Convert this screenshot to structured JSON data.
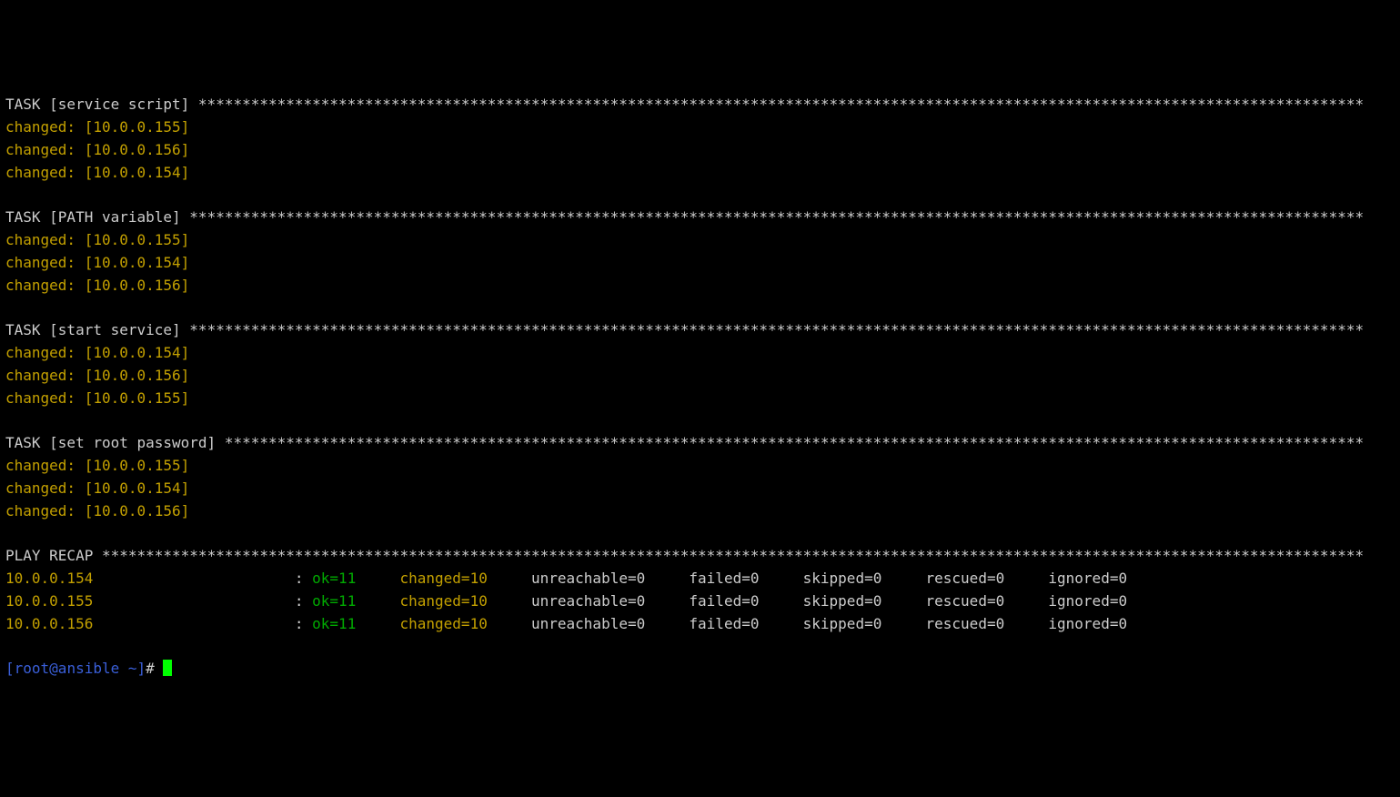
{
  "tasks": [
    {
      "name": "service script",
      "results": [
        {
          "status": "changed",
          "host": "10.0.0.155"
        },
        {
          "status": "changed",
          "host": "10.0.0.156"
        },
        {
          "status": "changed",
          "host": "10.0.0.154"
        }
      ]
    },
    {
      "name": "PATH variable",
      "results": [
        {
          "status": "changed",
          "host": "10.0.0.155"
        },
        {
          "status": "changed",
          "host": "10.0.0.154"
        },
        {
          "status": "changed",
          "host": "10.0.0.156"
        }
      ]
    },
    {
      "name": "start service",
      "results": [
        {
          "status": "changed",
          "host": "10.0.0.154"
        },
        {
          "status": "changed",
          "host": "10.0.0.156"
        },
        {
          "status": "changed",
          "host": "10.0.0.155"
        }
      ]
    },
    {
      "name": "set root password",
      "results": [
        {
          "status": "changed",
          "host": "10.0.0.155"
        },
        {
          "status": "changed",
          "host": "10.0.0.154"
        },
        {
          "status": "changed",
          "host": "10.0.0.156"
        }
      ]
    }
  ],
  "recap_heading": "PLAY RECAP",
  "recap": [
    {
      "host": "10.0.0.154",
      "ok": 11,
      "changed": 10,
      "unreachable": 0,
      "failed": 0,
      "skipped": 0,
      "rescued": 0,
      "ignored": 0
    },
    {
      "host": "10.0.0.155",
      "ok": 11,
      "changed": 10,
      "unreachable": 0,
      "failed": 0,
      "skipped": 0,
      "rescued": 0,
      "ignored": 0
    },
    {
      "host": "10.0.0.156",
      "ok": 11,
      "changed": 10,
      "unreachable": 0,
      "failed": 0,
      "skipped": 0,
      "rescued": 0,
      "ignored": 0
    }
  ],
  "prompt": {
    "user": "root",
    "host": "ansible",
    "cwd": "~",
    "symbol": "#"
  },
  "task_label_prefix": "TASK"
}
